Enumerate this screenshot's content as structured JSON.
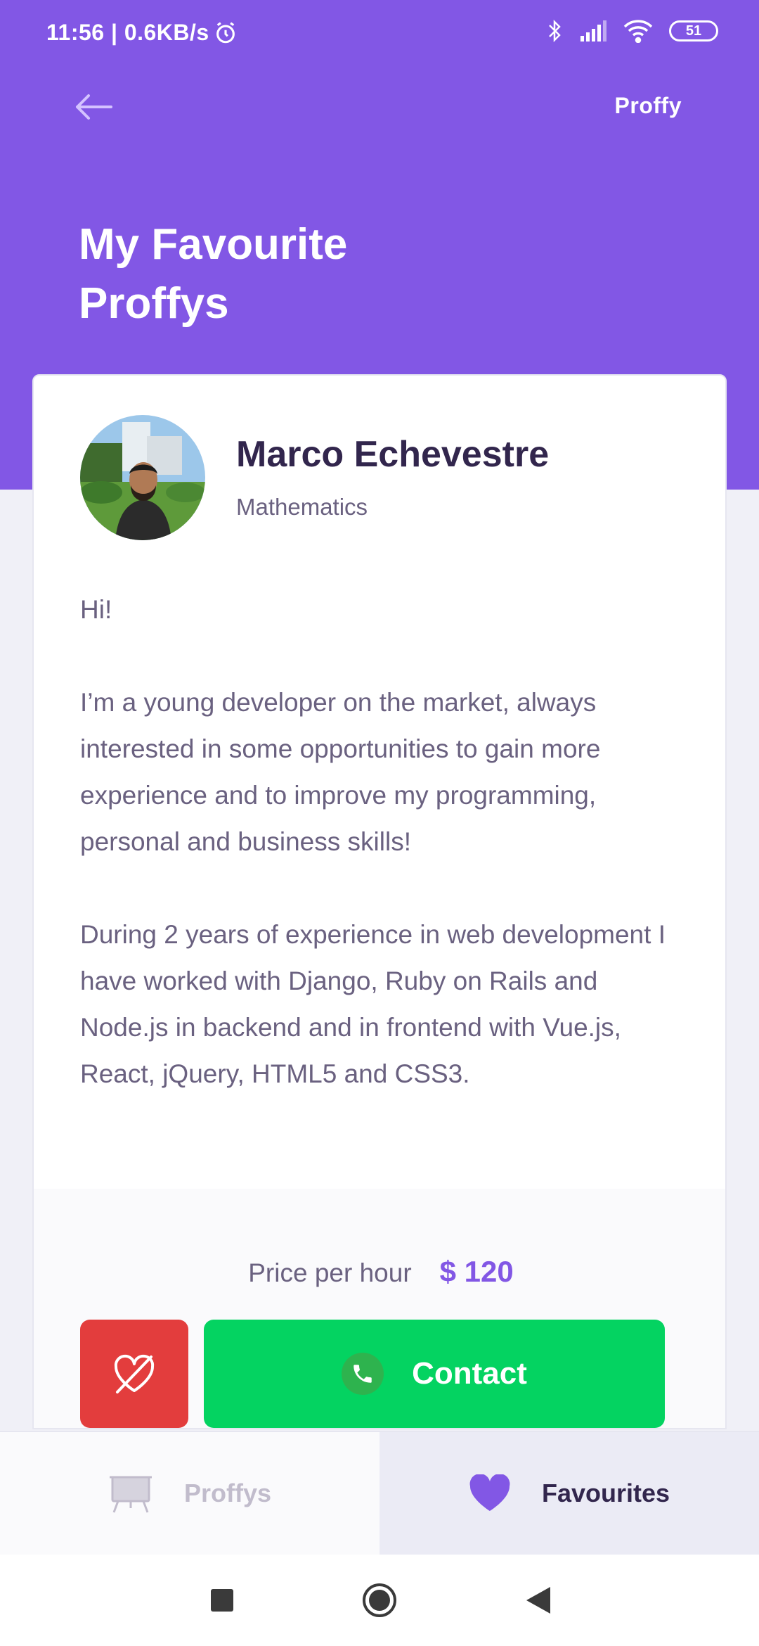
{
  "status_bar": {
    "time_speed": "11:56 | 0.6KB/s",
    "battery": "51"
  },
  "header": {
    "brand": "Proffy",
    "title": "My Favourite Proffys"
  },
  "teacher": {
    "name": "Marco Echevestre",
    "subject": "Mathematics",
    "bio": [
      "Hi!",
      "I’m a young developer on the market, always interested in some opportunities to gain more experience and to improve my programming, personal and business skills!",
      "During 2 years of experience in web development I have worked with Django, Ruby on Rails and Node.js in backend and in frontend with Vue.js, React, jQuery, HTML5 and CSS3."
    ],
    "price_label": "Price per hour",
    "price_value": "$ 120",
    "contact_label": "Contact"
  },
  "tabs": [
    {
      "label": "Proffys",
      "icon": "easel-icon",
      "active": false
    },
    {
      "label": "Favourites",
      "icon": "heart-icon",
      "active": true
    }
  ],
  "colors": {
    "primary": "#8257E5",
    "danger": "#E33D3D",
    "success": "#04D361",
    "title_dark": "#32264D",
    "text": "#6A6180"
  }
}
